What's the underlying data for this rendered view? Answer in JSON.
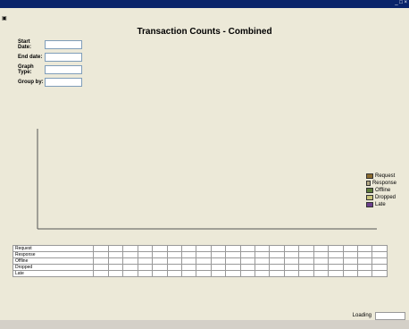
{
  "window": {
    "title": ""
  },
  "menu": {
    "items": [
      ""
    ]
  },
  "report": {
    "title": "Transaction Counts - Combined"
  },
  "form": {
    "start_label": "Start Date:",
    "start_value": "",
    "end_label": "End date:",
    "end_value": "",
    "graph_type_label": "Graph Type:",
    "graph_type_value": "",
    "group_by_label": "Group by:",
    "group_by_value": ""
  },
  "status": {
    "loading_label": "Loading",
    "progress_value": ""
  },
  "chart_data": {
    "type": "bar",
    "title": "Transaction Counts - Combined",
    "xlabel": "",
    "ylabel": "",
    "categories": [
      "",
      "",
      "",
      "",
      "",
      "",
      "",
      "",
      "",
      "",
      "",
      "",
      "",
      "",
      "",
      "",
      "",
      "",
      "",
      ""
    ],
    "series": [
      {
        "name": "Request",
        "values": [
          0,
          0,
          0,
          0,
          0,
          0,
          0,
          0,
          0,
          0,
          0,
          0,
          0,
          0,
          0,
          0,
          0,
          0,
          0,
          0
        ]
      },
      {
        "name": "Response",
        "values": [
          0,
          0,
          0,
          0,
          0,
          0,
          0,
          0,
          0,
          0,
          0,
          0,
          0,
          0,
          0,
          0,
          0,
          0,
          0,
          0
        ]
      },
      {
        "name": "Offline",
        "values": [
          0,
          0,
          0,
          0,
          0,
          0,
          0,
          0,
          0,
          0,
          0,
          0,
          0,
          0,
          0,
          0,
          0,
          0,
          0,
          0
        ]
      },
      {
        "name": "Dropped",
        "values": [
          0,
          0,
          0,
          0,
          0,
          0,
          0,
          0,
          0,
          0,
          0,
          0,
          0,
          0,
          0,
          0,
          0,
          0,
          0,
          0
        ]
      },
      {
        "name": "Late",
        "values": [
          0,
          0,
          0,
          0,
          0,
          0,
          0,
          0,
          0,
          0,
          0,
          0,
          0,
          0,
          0,
          0,
          0,
          0,
          0,
          0
        ]
      }
    ],
    "legend_title": "",
    "legend_position": "right",
    "colors": [
      "#8b6b2e",
      "#b4a884",
      "#5e7c3a",
      "#c9c47a",
      "#6b3f8c"
    ]
  },
  "table": {
    "headers": [
      "",
      "",
      "",
      "",
      "",
      "",
      "",
      "",
      "",
      "",
      "",
      "",
      "",
      "",
      "",
      "",
      "",
      "",
      "",
      "",
      ""
    ],
    "rows": [
      {
        "label": "Request",
        "cells": [
          "",
          "",
          "",
          "",
          "",
          "",
          "",
          "",
          "",
          "",
          "",
          "",
          "",
          "",
          "",
          "",
          "",
          "",
          "",
          ""
        ]
      },
      {
        "label": "Response",
        "cells": [
          "",
          "",
          "",
          "",
          "",
          "",
          "",
          "",
          "",
          "",
          "",
          "",
          "",
          "",
          "",
          "",
          "",
          "",
          "",
          ""
        ]
      },
      {
        "label": "Offline",
        "cells": [
          "",
          "",
          "",
          "",
          "",
          "",
          "",
          "",
          "",
          "",
          "",
          "",
          "",
          "",
          "",
          "",
          "",
          "",
          "",
          ""
        ]
      },
      {
        "label": "Dropped",
        "cells": [
          "",
          "",
          "",
          "",
          "",
          "",
          "",
          "",
          "",
          "",
          "",
          "",
          "",
          "",
          "",
          "",
          "",
          "",
          "",
          ""
        ]
      },
      {
        "label": "Late",
        "cells": [
          "",
          "",
          "",
          "",
          "",
          "",
          "",
          "",
          "",
          "",
          "",
          "",
          "",
          "",
          "",
          "",
          "",
          "",
          "",
          ""
        ]
      }
    ]
  }
}
